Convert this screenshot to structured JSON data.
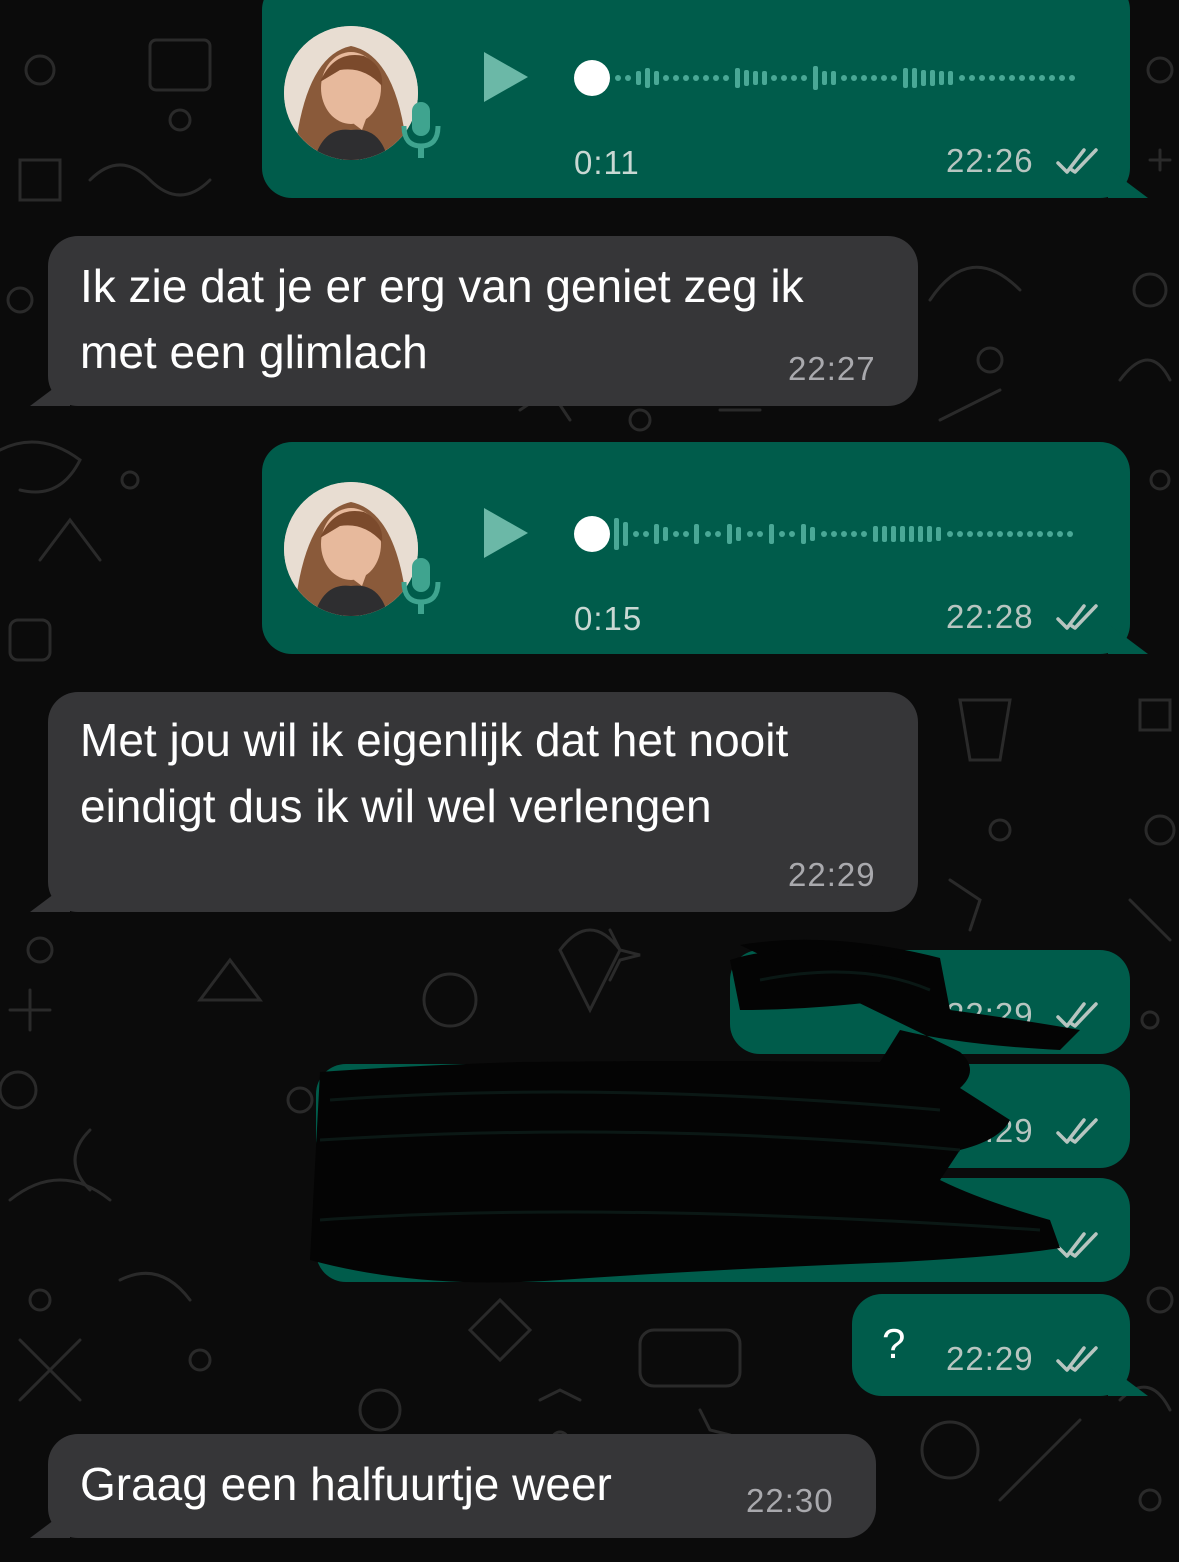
{
  "colors": {
    "background": "#0b0b0b",
    "outgoing_bubble": "#005c4b",
    "incoming_bubble": "#363638",
    "read_ticks": "#b7c5c0",
    "redaction": "#050505"
  },
  "icons": {
    "play": "play-icon",
    "mic": "mic-icon",
    "read": "double-check-icon"
  },
  "messages": [
    {
      "type": "voice",
      "direction": "outgoing",
      "duration": "0:11",
      "time": "22:26",
      "status": "read"
    },
    {
      "type": "text",
      "direction": "incoming",
      "text": "Ik zie dat je er erg van geniet zeg ik met een glimlach",
      "line1": "Ik zie dat je er erg van geniet zeg ik",
      "line2": "met een glimlach",
      "time": "22:27"
    },
    {
      "type": "voice",
      "direction": "outgoing",
      "duration": "0:15",
      "time": "22:28",
      "status": "read"
    },
    {
      "type": "text",
      "direction": "incoming",
      "text": "Met jou wil ik eigenlijk dat het nooit eindigt dus ik wil wel verlengen",
      "line1": "Met jou wil ik eigenlijk dat het nooit",
      "line2": "eindigt dus ik wil wel verlengen",
      "time": "22:29"
    },
    {
      "type": "text",
      "direction": "outgoing",
      "redacted": true,
      "time": "22:29",
      "status": "read"
    },
    {
      "type": "text",
      "direction": "outgoing",
      "redacted": true,
      "time": "22:29",
      "status": "read"
    },
    {
      "type": "text",
      "direction": "outgoing",
      "redacted": true,
      "time": "",
      "status": "read"
    },
    {
      "type": "text",
      "direction": "outgoing",
      "text": "?",
      "time": "22:29",
      "status": "read"
    },
    {
      "type": "text",
      "direction": "incoming",
      "text": "Graag een halfuurtje weer",
      "time": "22:30"
    }
  ]
}
